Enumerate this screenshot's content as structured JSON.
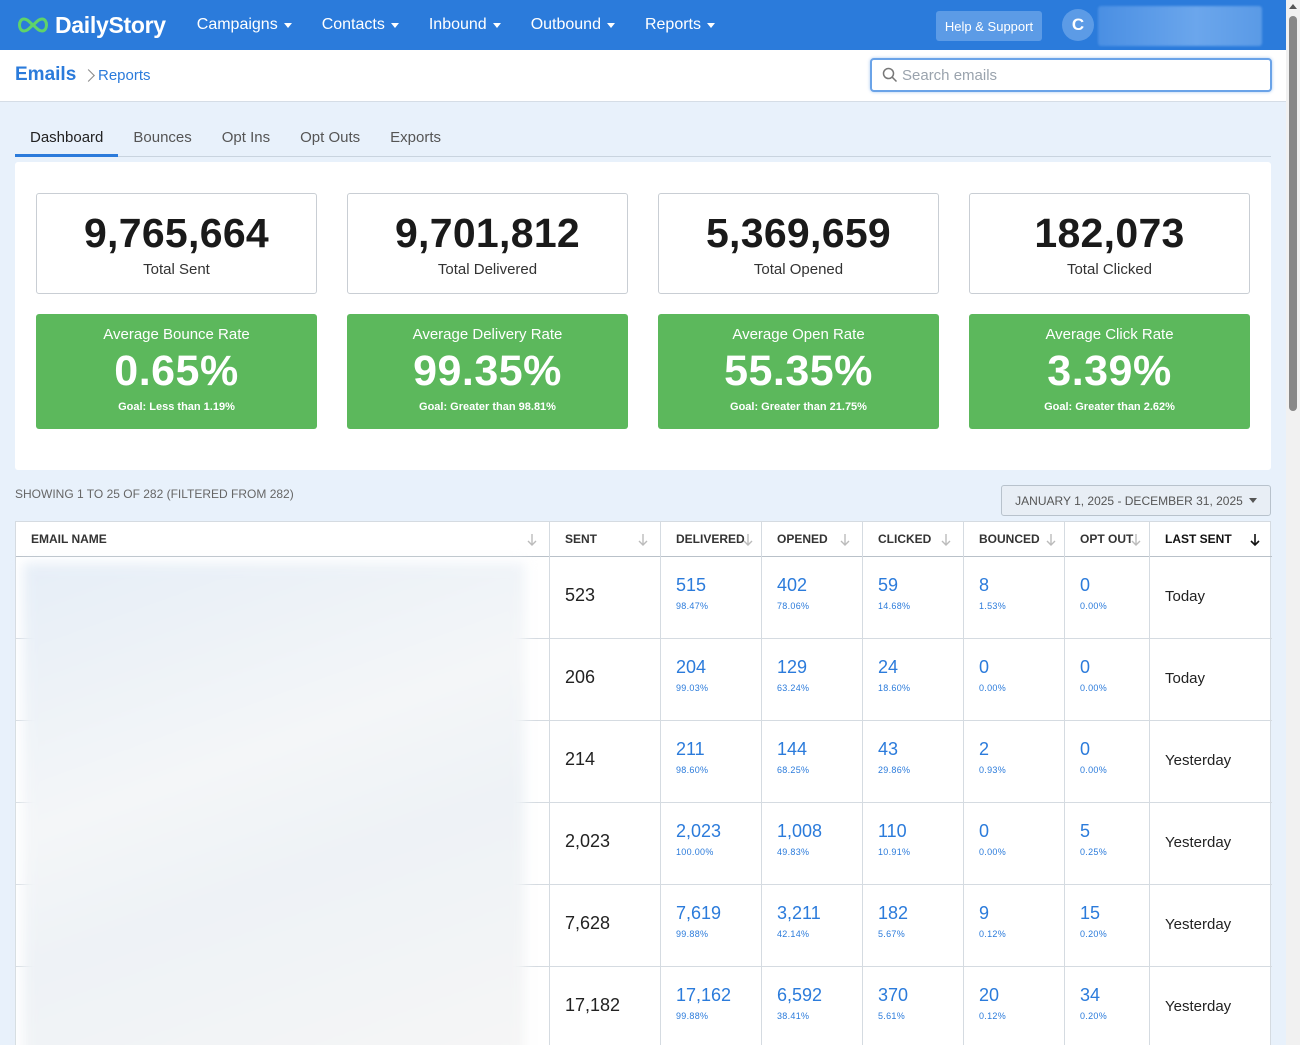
{
  "nav": {
    "logo_text": "DailyStory",
    "menu": [
      "Campaigns",
      "Contacts",
      "Inbound",
      "Outbound",
      "Reports"
    ],
    "help_label": "Help & Support",
    "avatar_initial": "C"
  },
  "breadcrumb": {
    "root": "Emails",
    "current": "Reports"
  },
  "search": {
    "placeholder": "Search emails",
    "value": ""
  },
  "tabs": [
    "Dashboard",
    "Bounces",
    "Opt Ins",
    "Opt Outs",
    "Exports"
  ],
  "stats": [
    {
      "value": "9,765,664",
      "label": "Total Sent"
    },
    {
      "value": "9,701,812",
      "label": "Total Delivered"
    },
    {
      "value": "5,369,659",
      "label": "Total Opened"
    },
    {
      "value": "182,073",
      "label": "Total Clicked"
    }
  ],
  "rates": [
    {
      "label": "Average Bounce Rate",
      "value": "0.65%",
      "goal": "Goal: Less than 1.19%"
    },
    {
      "label": "Average Delivery Rate",
      "value": "99.35%",
      "goal": "Goal: Greater than 98.81%"
    },
    {
      "label": "Average Open Rate",
      "value": "55.35%",
      "goal": "Goal: Greater than 21.75%"
    },
    {
      "label": "Average Click Rate",
      "value": "3.39%",
      "goal": "Goal: Greater than 2.62%"
    }
  ],
  "colors": {
    "nav": "#2b7bdb",
    "rate_card": "#5cb85c",
    "link": "#2b7bdb"
  },
  "table": {
    "showing": "SHOWING 1 TO 25 OF 282 (FILTERED FROM 282)",
    "date_range": "JANUARY 1, 2025 - DECEMBER 31, 2025",
    "headers": [
      "EMAIL NAME",
      "SENT",
      "DELIVERED",
      "OPENED",
      "CLICKED",
      "BOUNCED",
      "OPT OUT",
      "LAST SENT"
    ],
    "rows": [
      {
        "sent": "523",
        "delivered": "515",
        "delivered_pct": "98.47%",
        "opened": "402",
        "opened_pct": "78.06%",
        "clicked": "59",
        "clicked_pct": "14.68%",
        "bounced": "8",
        "bounced_pct": "1.53%",
        "optout": "0",
        "optout_pct": "0.00%",
        "last_sent": "Today"
      },
      {
        "sent": "206",
        "delivered": "204",
        "delivered_pct": "99.03%",
        "opened": "129",
        "opened_pct": "63.24%",
        "clicked": "24",
        "clicked_pct": "18.60%",
        "bounced": "0",
        "bounced_pct": "0.00%",
        "optout": "0",
        "optout_pct": "0.00%",
        "last_sent": "Today"
      },
      {
        "sent": "214",
        "delivered": "211",
        "delivered_pct": "98.60%",
        "opened": "144",
        "opened_pct": "68.25%",
        "clicked": "43",
        "clicked_pct": "29.86%",
        "bounced": "2",
        "bounced_pct": "0.93%",
        "optout": "0",
        "optout_pct": "0.00%",
        "last_sent": "Yesterday"
      },
      {
        "sent": "2,023",
        "delivered": "2,023",
        "delivered_pct": "100.00%",
        "opened": "1,008",
        "opened_pct": "49.83%",
        "clicked": "110",
        "clicked_pct": "10.91%",
        "bounced": "0",
        "bounced_pct": "0.00%",
        "optout": "5",
        "optout_pct": "0.25%",
        "last_sent": "Yesterday"
      },
      {
        "sent": "7,628",
        "delivered": "7,619",
        "delivered_pct": "99.88%",
        "opened": "3,211",
        "opened_pct": "42.14%",
        "clicked": "182",
        "clicked_pct": "5.67%",
        "bounced": "9",
        "bounced_pct": "0.12%",
        "optout": "15",
        "optout_pct": "0.20%",
        "last_sent": "Yesterday"
      },
      {
        "sent": "17,182",
        "delivered": "17,162",
        "delivered_pct": "99.88%",
        "opened": "6,592",
        "opened_pct": "38.41%",
        "clicked": "370",
        "clicked_pct": "5.61%",
        "bounced": "20",
        "bounced_pct": "0.12%",
        "optout": "34",
        "optout_pct": "0.20%",
        "last_sent": "Yesterday"
      }
    ]
  }
}
